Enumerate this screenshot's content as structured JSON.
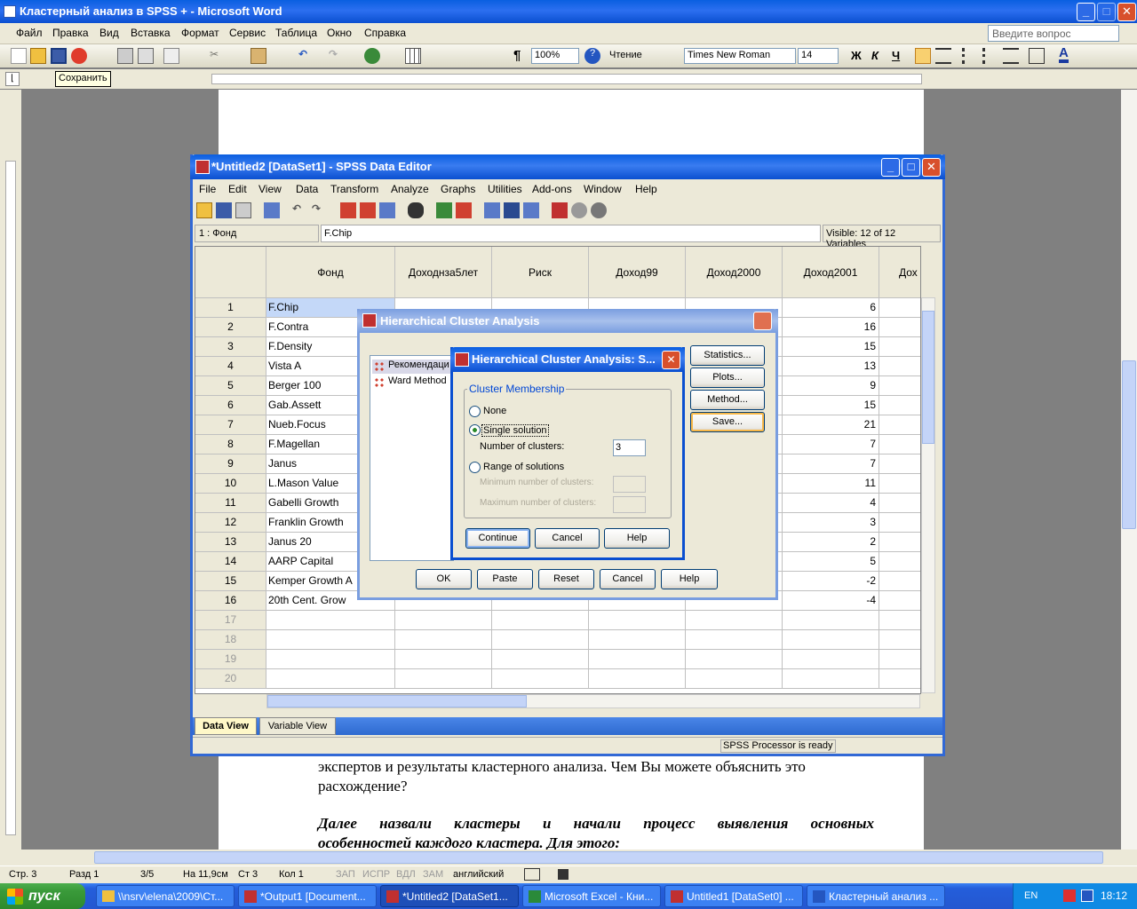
{
  "word": {
    "title": "Кластерный анализ в SPSS + - Microsoft Word",
    "menu": [
      "Файл",
      "Правка",
      "Вид",
      "Вставка",
      "Формат",
      "Сервис",
      "Таблица",
      "Окно",
      "Справка"
    ],
    "help_placeholder": "Введите вопрос",
    "zoom": "100%",
    "reading": "Чтение",
    "font_name": "Times New Roman",
    "font_size": "14",
    "bold": "Ж",
    "italic": "К",
    "underline": "Ч",
    "tooltip": "Сохранить",
    "doc_line1": "экспертов и результаты кластерного анализа. Чем Вы можете объяснить это",
    "doc_line2": "расхождение?",
    "doc_line3": "Далее назвали кластеры и начали процесс выявления основных",
    "doc_line4": "особенностей каждого кластера. Для этого:",
    "status": {
      "page": "Стр. 3",
      "section": "Разд 1",
      "pages": "3/5",
      "at": "На 11,9см",
      "line": "Ст 3",
      "col": "Кол 1",
      "rec": "ЗАП",
      "trk": "ИСПР",
      "ext": "ВДЛ",
      "ovr": "ЗАМ",
      "lang": "английский"
    }
  },
  "taskbar": {
    "start": "пуск",
    "tasks": [
      "\\\\nsrv\\elena\\2009\\Ст...",
      "*Output1 [Document...",
      "*Untitled2 [DataSet1...",
      "Microsoft Excel - Кни...",
      "Untitled1 [DataSet0] ...",
      "Кластерный анализ ..."
    ],
    "lang": "EN",
    "clock": "18:12"
  },
  "spss": {
    "title": "*Untitled2 [DataSet1] - SPSS Data Editor",
    "menu": [
      "File",
      "Edit",
      "View",
      "Data",
      "Transform",
      "Analyze",
      "Graphs",
      "Utilities",
      "Add-ons",
      "Window",
      "Help"
    ],
    "cell_ref": "1 : Фонд",
    "cell_value": "F.Chip",
    "visible": "Visible: 12 of 12 Variables",
    "columns": [
      "Фонд",
      "Доходнза5лет",
      "Риск",
      "Доход99",
      "Доход2000",
      "Доход2001",
      "Дох"
    ],
    "rows": [
      {
        "n": "1",
        "name": "F.Chip",
        "last": "6"
      },
      {
        "n": "2",
        "name": "F.Contra",
        "last": "16"
      },
      {
        "n": "3",
        "name": "F.Density",
        "last": "15"
      },
      {
        "n": "4",
        "name": "Vista A",
        "last": "13"
      },
      {
        "n": "5",
        "name": "Berger 100",
        "last": "9"
      },
      {
        "n": "6",
        "name": "Gab.Assett",
        "last": "15"
      },
      {
        "n": "7",
        "name": "Nueb.Focus",
        "last": "21"
      },
      {
        "n": "8",
        "name": "F.Magellan",
        "last": "7"
      },
      {
        "n": "9",
        "name": "Janus",
        "last": "7"
      },
      {
        "n": "10",
        "name": "L.Mason Value",
        "last": "11"
      },
      {
        "n": "11",
        "name": "Gabelli Growth",
        "last": "4"
      },
      {
        "n": "12",
        "name": "Franklin Growth",
        "last": "3"
      },
      {
        "n": "13",
        "name": "Janus 20",
        "last": "2"
      },
      {
        "n": "14",
        "name": "AARP Capital",
        "last": "5"
      },
      {
        "n": "15",
        "name": "Kemper Growth A",
        "last": "-2"
      },
      {
        "n": "16",
        "name": "20th Cent. Grow",
        "last": "-4"
      },
      {
        "n": "17",
        "name": "",
        "last": ""
      },
      {
        "n": "18",
        "name": "",
        "last": ""
      },
      {
        "n": "19",
        "name": "",
        "last": ""
      },
      {
        "n": "20",
        "name": "",
        "last": ""
      }
    ],
    "tab_data": "Data View",
    "tab_variable": "Variable View",
    "status": "SPSS  Processor is ready"
  },
  "hca": {
    "title": "Hierarchical Cluster Analysis",
    "list": [
      "Рекомендаци",
      "Ward Method"
    ],
    "side_buttons": [
      "Statistics...",
      "Plots...",
      "Method...",
      "Save..."
    ],
    "bottom_buttons": [
      "OK",
      "Paste",
      "Reset",
      "Cancel",
      "Help"
    ]
  },
  "save_dialog": {
    "title": "Hierarchical Cluster Analysis: S...",
    "group": "Cluster Membership",
    "none": "None",
    "single": "Single solution",
    "num_clusters_label": "Number of clusters:",
    "num_clusters_value": "3",
    "range": "Range of solutions",
    "min_label": "Minimum number of clusters:",
    "max_label": "Maximum number of clusters:",
    "continue": "Continue",
    "cancel": "Cancel",
    "help": "Help"
  }
}
